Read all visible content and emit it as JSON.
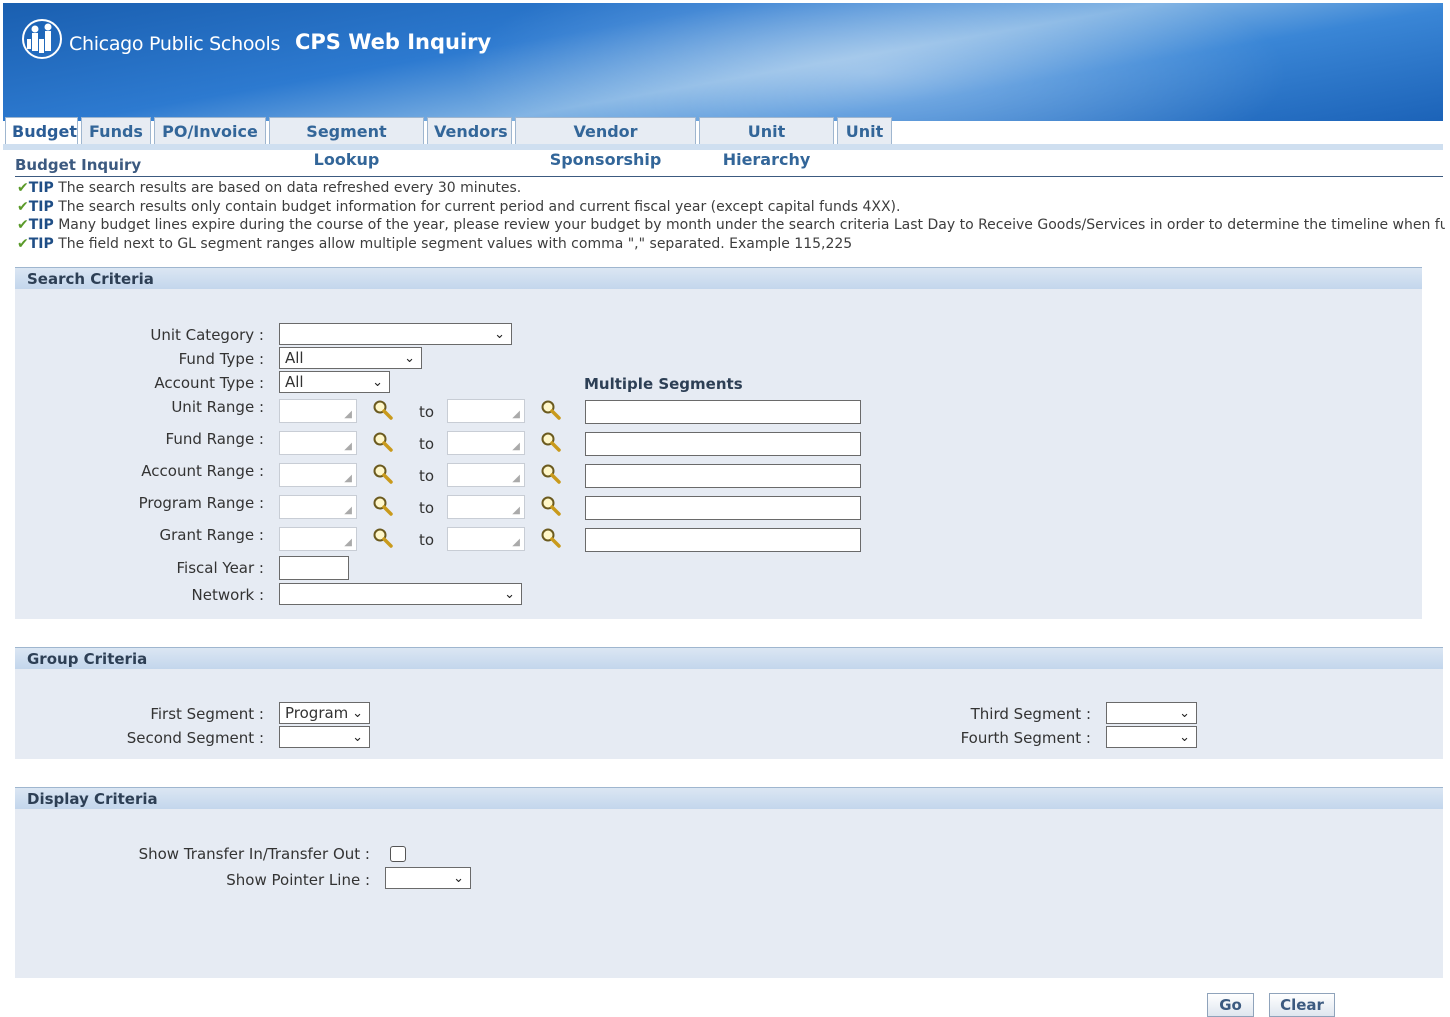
{
  "header": {
    "logo_text": "Chicago Public Schools",
    "app_title": "CPS Web Inquiry"
  },
  "tabs": [
    {
      "label": "Budget",
      "active": true
    },
    {
      "label": "Funds"
    },
    {
      "label": "PO/Invoice"
    },
    {
      "label": "Segment Lookup"
    },
    {
      "label": "Vendors"
    },
    {
      "label": "Vendor Sponsorship"
    },
    {
      "label": "Unit Hierarchy"
    },
    {
      "label": "Unit"
    }
  ],
  "page_title": "Budget Inquiry",
  "tips": [
    {
      "tag": "TIP",
      "text": " The search results are based on data refreshed every 30 minutes."
    },
    {
      "tag": "TIP",
      "text": " The search results only contain budget information for current period and current fiscal year (except capital funds 4XX)."
    },
    {
      "tag": "TIP",
      "text": " Many budget lines expire during the course of the year, please review your budget by month under the search criteria Last Day to Receive Goods/Services in order to determine the timeline when fu"
    },
    {
      "tag": "TIP",
      "text": " The field next to GL segment ranges allow multiple segment values with comma \",\" separated. Example 115,225"
    }
  ],
  "search_criteria": {
    "heading": "Search Criteria",
    "unit_category": {
      "label": "Unit Category :",
      "value": ""
    },
    "fund_type": {
      "label": "Fund Type :",
      "value": "All"
    },
    "account_type": {
      "label": "Account Type :",
      "value": "All"
    },
    "multiple_segments_label": "Multiple Segments",
    "to_label": "to",
    "ranges": [
      {
        "label": "Unit Range :"
      },
      {
        "label": "Fund Range :"
      },
      {
        "label": "Account Range :"
      },
      {
        "label": "Program Range :"
      },
      {
        "label": "Grant Range :"
      }
    ],
    "fiscal_year": {
      "label": "Fiscal Year :",
      "value": ""
    },
    "network": {
      "label": "Network :",
      "value": ""
    }
  },
  "group_criteria": {
    "heading": "Group Criteria",
    "first_segment": {
      "label": "First Segment :",
      "value": "Program"
    },
    "second_segment": {
      "label": "Second Segment :",
      "value": ""
    },
    "third_segment": {
      "label": "Third Segment :",
      "value": ""
    },
    "fourth_segment": {
      "label": "Fourth Segment :",
      "value": ""
    }
  },
  "display_criteria": {
    "heading": "Display Criteria",
    "show_transfer": {
      "label": "Show Transfer In/Transfer Out :",
      "checked": false
    },
    "show_pointer": {
      "label": "Show Pointer Line :",
      "value": ""
    }
  },
  "buttons": {
    "go": "Go",
    "clear": "Clear"
  },
  "icons": {
    "lookup": "search-icon",
    "chevron": "chevron-down-icon",
    "tip": "check-icon"
  }
}
